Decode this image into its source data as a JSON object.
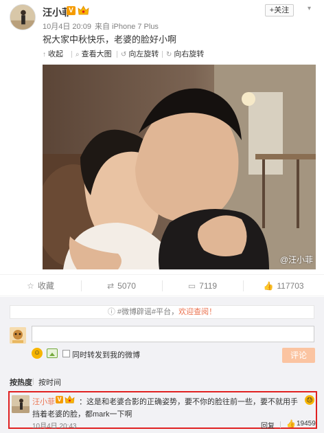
{
  "post": {
    "author": "汪小菲",
    "verified_badge": "V",
    "time": "10月4日 20:09",
    "from": "来自 iPhone 7 Plus",
    "follow_label": "+关注",
    "text": "祝大家中秋快乐，老婆的脸好小啊",
    "media_toolbar": {
      "collapse": "收起",
      "view_large": "查看大图",
      "rotate_left": "向左旋转",
      "rotate_right": "向右旋转"
    },
    "watermark": "@汪小菲"
  },
  "actions": {
    "favorite": "收藏",
    "repost": "5070",
    "comment": "7119",
    "like": "117703"
  },
  "comment_box": {
    "topic_prefix": "#微博辟谣#平台，",
    "topic_link": "欢迎查阅！",
    "input_value": "",
    "forward_label": "同时转发到我的微博",
    "submit_label": "评论"
  },
  "sort_tabs": {
    "by_hot": "按热度",
    "by_time": "按时间"
  },
  "top_comment": {
    "name": "汪小菲",
    "verified_badge": "V",
    "text": "：这是和老婆合影的正确姿势，要不你的脸往前一些，要不就用手挡着老婆的脸，都mark一下啊",
    "time": "10月4日 20:43",
    "reply_label": "回复",
    "likes": "19459"
  },
  "colors": {
    "accent_orange": "#eb7350",
    "verified": "#f59b00",
    "highlight_border": "#e02020",
    "submit_disabled": "#fbc4a1"
  },
  "icons": {
    "collapse": "arrow-up-icon",
    "view_large": "magnifier-icon",
    "rotate_left": "rotate-left-icon",
    "rotate_right": "rotate-right-icon",
    "favorite": "star-icon",
    "repost": "repost-icon",
    "comment": "comment-icon",
    "like": "thumbs-up-icon",
    "emoji": "smiley-icon",
    "image": "picture-icon"
  }
}
